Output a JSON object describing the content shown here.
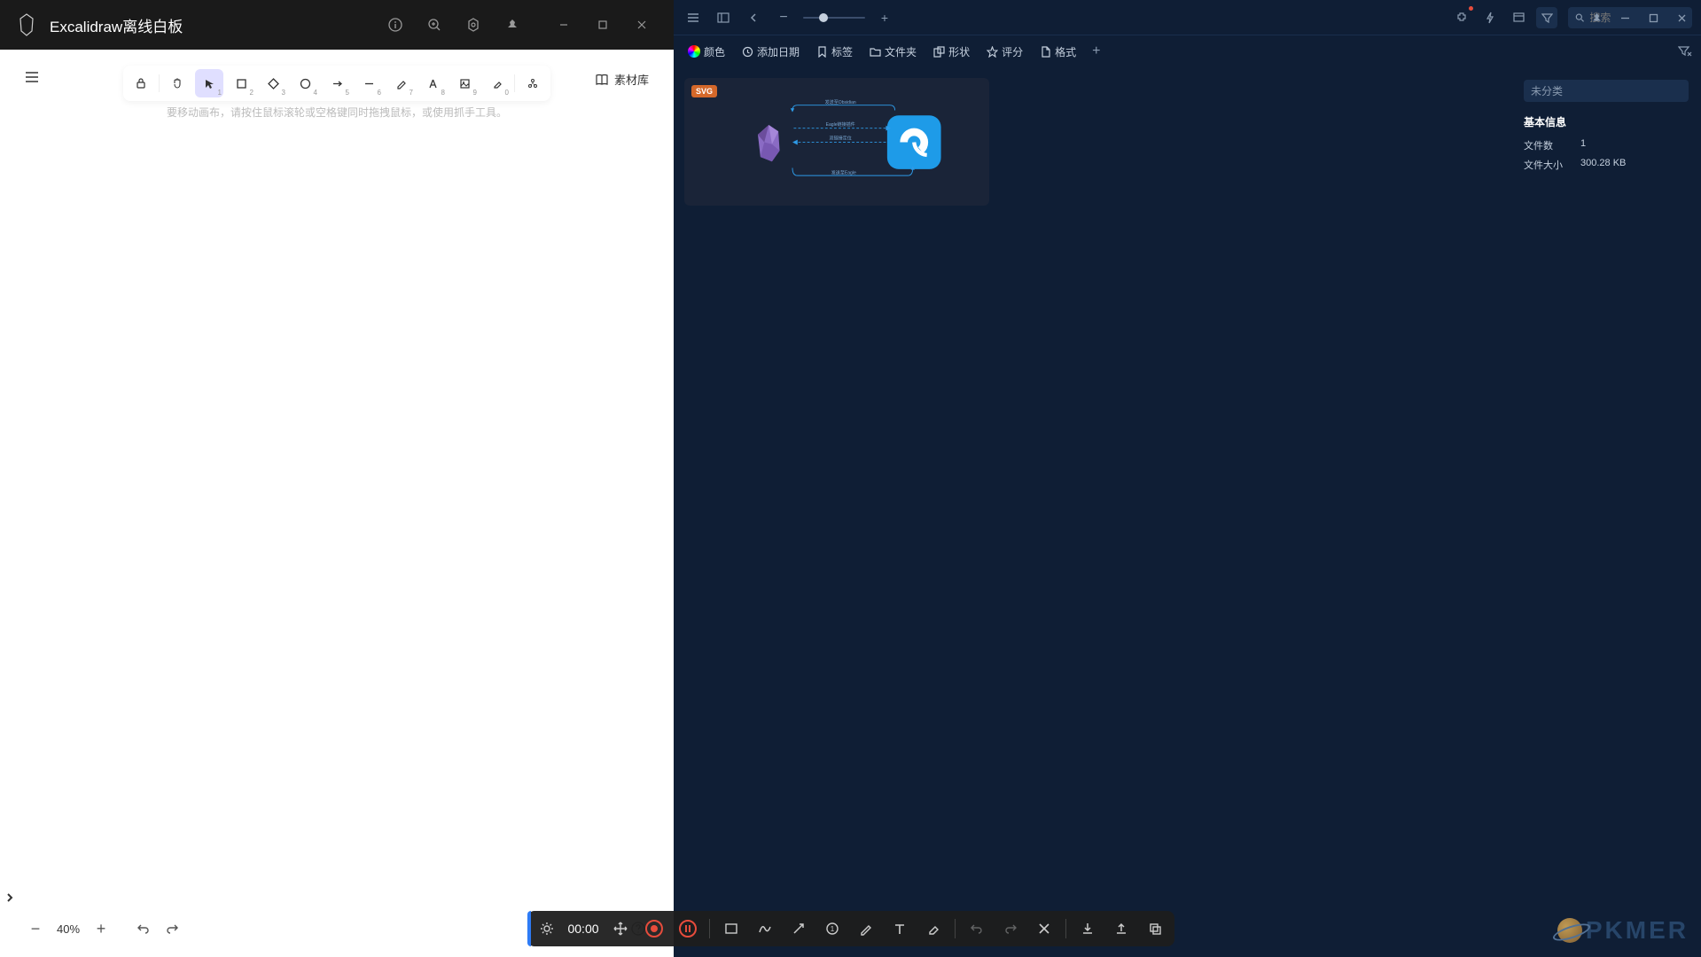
{
  "excalidraw": {
    "title": "Excalidraw离线白板",
    "canvas_hint": "要移动画布，请按住鼠标滚轮或空格键同时拖拽鼠标，或使用抓手工具。",
    "library_label": "素材库",
    "zoom_label": "40%",
    "tools": [
      "1",
      "2",
      "3",
      "4",
      "5",
      "6",
      "7",
      "8",
      "9",
      "0"
    ]
  },
  "eagle": {
    "search_placeholder": "搜索",
    "filters": {
      "color": "颜色",
      "date": "添加日期",
      "tag": "标签",
      "folder": "文件夹",
      "shape": "形状",
      "rating": "评分",
      "format": "格式"
    },
    "thumbnail": {
      "badge": "SVG",
      "arrow_top": "发送至Obsidian",
      "arrow_mid_1": "Eagle链接插件",
      "arrow_mid_2": "双链接定位",
      "arrow_bottom": "发送至Eagle"
    },
    "details": {
      "tab1": "未分类",
      "section_title": "基本信息",
      "file_count_label": "文件数",
      "file_count_value": "1",
      "file_size_label": "文件大小",
      "file_size_value": "300.28 KB"
    }
  },
  "recorder": {
    "time": "00:00"
  },
  "watermark": "PKMER"
}
